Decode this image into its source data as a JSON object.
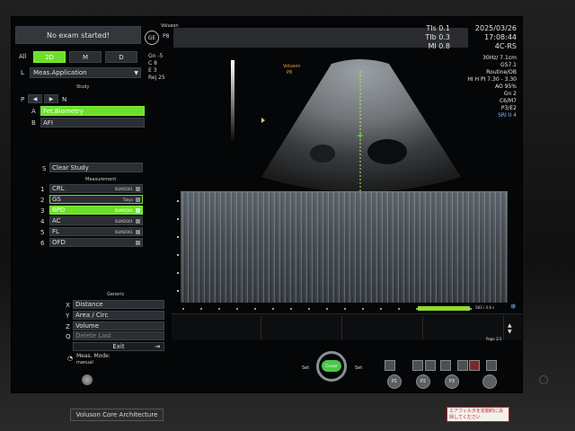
{
  "header": {
    "status": "No exam started!",
    "brand": "Voluson",
    "probe": "P8",
    "logo": "GE"
  },
  "mode_tabs": {
    "all": "All",
    "mode_2d": "2D",
    "m": "M",
    "d": "D",
    "active": "2D"
  },
  "left_panel": {
    "l_key": "L",
    "meas_app": "Meas.Application",
    "study_header": "Study",
    "p_key": "P",
    "n_key": "N",
    "studies": [
      {
        "key": "A",
        "label": "Fet.Biometry",
        "active": true
      },
      {
        "key": "B",
        "label": "AFI",
        "active": false
      }
    ],
    "s_key": "S",
    "clear_study": "Clear Study",
    "measurement_header": "Measurement",
    "measurements": [
      {
        "key": "1",
        "label": "CRL",
        "tag": "ISUM2001",
        "active": false
      },
      {
        "key": "2",
        "label": "GS",
        "tag": "Tokyo",
        "active": false
      },
      {
        "key": "3",
        "label": "BPD",
        "tag": "ISUM2001",
        "active": true
      },
      {
        "key": "4",
        "label": "AC",
        "tag": "ISUM2001",
        "active": false
      },
      {
        "key": "5",
        "label": "FL",
        "tag": "ISUM2001",
        "active": false
      },
      {
        "key": "6",
        "label": "OFD",
        "tag": "",
        "active": false
      }
    ],
    "generic_header": "Generic",
    "generic": [
      {
        "key": "X",
        "label": "Distance"
      },
      {
        "key": "Y",
        "label": "Area / Circ"
      },
      {
        "key": "Z",
        "label": "Volume"
      },
      {
        "key": "Q",
        "label": "Delete Last"
      }
    ],
    "exit": "Exit",
    "meas_mode_label": "Meas. Mode:",
    "meas_mode_value": "manual"
  },
  "top_info": {
    "gn": "Gn -5",
    "c": "C 8",
    "e": "E 3",
    "rej": "Rej 25"
  },
  "image_overlay": {
    "brand": "Voluson",
    "probe": "P8"
  },
  "right_panel": {
    "tis": "TIs 0.1",
    "tib": "TIb 0.3",
    "mi": "MI 0.8",
    "date": "2025/03/26",
    "time": "17:08:44",
    "probe_model": "4C-RS",
    "params": [
      "30Hz/ 7.1cm",
      "GS7.1",
      "Routine/OB",
      "HI H PI 7.30 - 3.30",
      "AO 95%",
      "Gn 2",
      "C6/M7",
      "P3/E2",
      "SRI II 4"
    ]
  },
  "mmode": {
    "counter": "583 / 4.6 s",
    "page": "Page 2/3"
  },
  "controls": {
    "set_left": "Set",
    "set_right": "Set",
    "cursor": "Cursor",
    "p1": "P1",
    "p2": "P2",
    "p3": "P3"
  },
  "bezel": {
    "label": "Voluson Core Architecture",
    "sticker": "エアフィルタを定期的に清掃してください"
  },
  "colors": {
    "accent_green": "#6be02a",
    "background": "#050607",
    "panel": "#2b2e33"
  }
}
